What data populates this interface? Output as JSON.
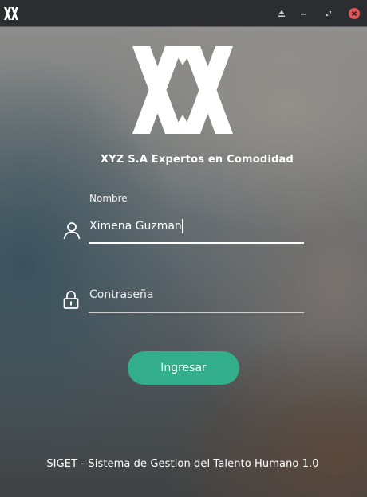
{
  "titlebar": {
    "app_icon": "xyz-logo-icon",
    "buttons": {
      "eject_icon": "eject-icon",
      "minimize_icon": "minimize-icon",
      "maximize_icon": "maximize-icon",
      "close_icon": "close-icon"
    },
    "close_color": "#e05757"
  },
  "brand": {
    "logo_icon": "xyz-logo-icon",
    "company_name": "XYZ S.A Expertos en Comodidad"
  },
  "form": {
    "username": {
      "label": "Nombre",
      "value": "Ximena Guzman",
      "icon": "user-icon"
    },
    "password": {
      "placeholder": "Contraseña",
      "value": "",
      "icon": "lock-icon"
    },
    "login_button": {
      "label": "Ingresar",
      "color": "#33ae8b"
    }
  },
  "footer": {
    "text": "SIGET - Sistema de Gestion del Talento Humano 1.0"
  }
}
